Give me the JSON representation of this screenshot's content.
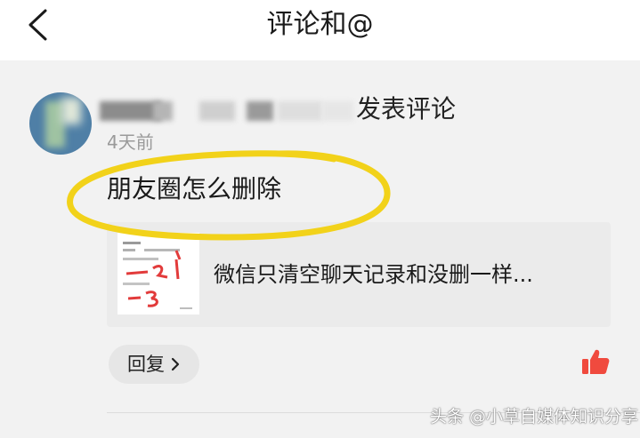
{
  "header": {
    "title": "评论和@",
    "back_icon": "chevron-left-icon"
  },
  "comment": {
    "action_text": "发表评论",
    "time": "4天前",
    "text": "朋友圈怎么删除",
    "article": {
      "title": "微信只清空聊天记录和没删一样..."
    },
    "reply_label": "回复",
    "like_icon": "thumbs-up-icon",
    "like_color": "#f04a3e",
    "highlight_color": "#f2d21a"
  },
  "watermark": "头条 @小草自媒体知识分享"
}
